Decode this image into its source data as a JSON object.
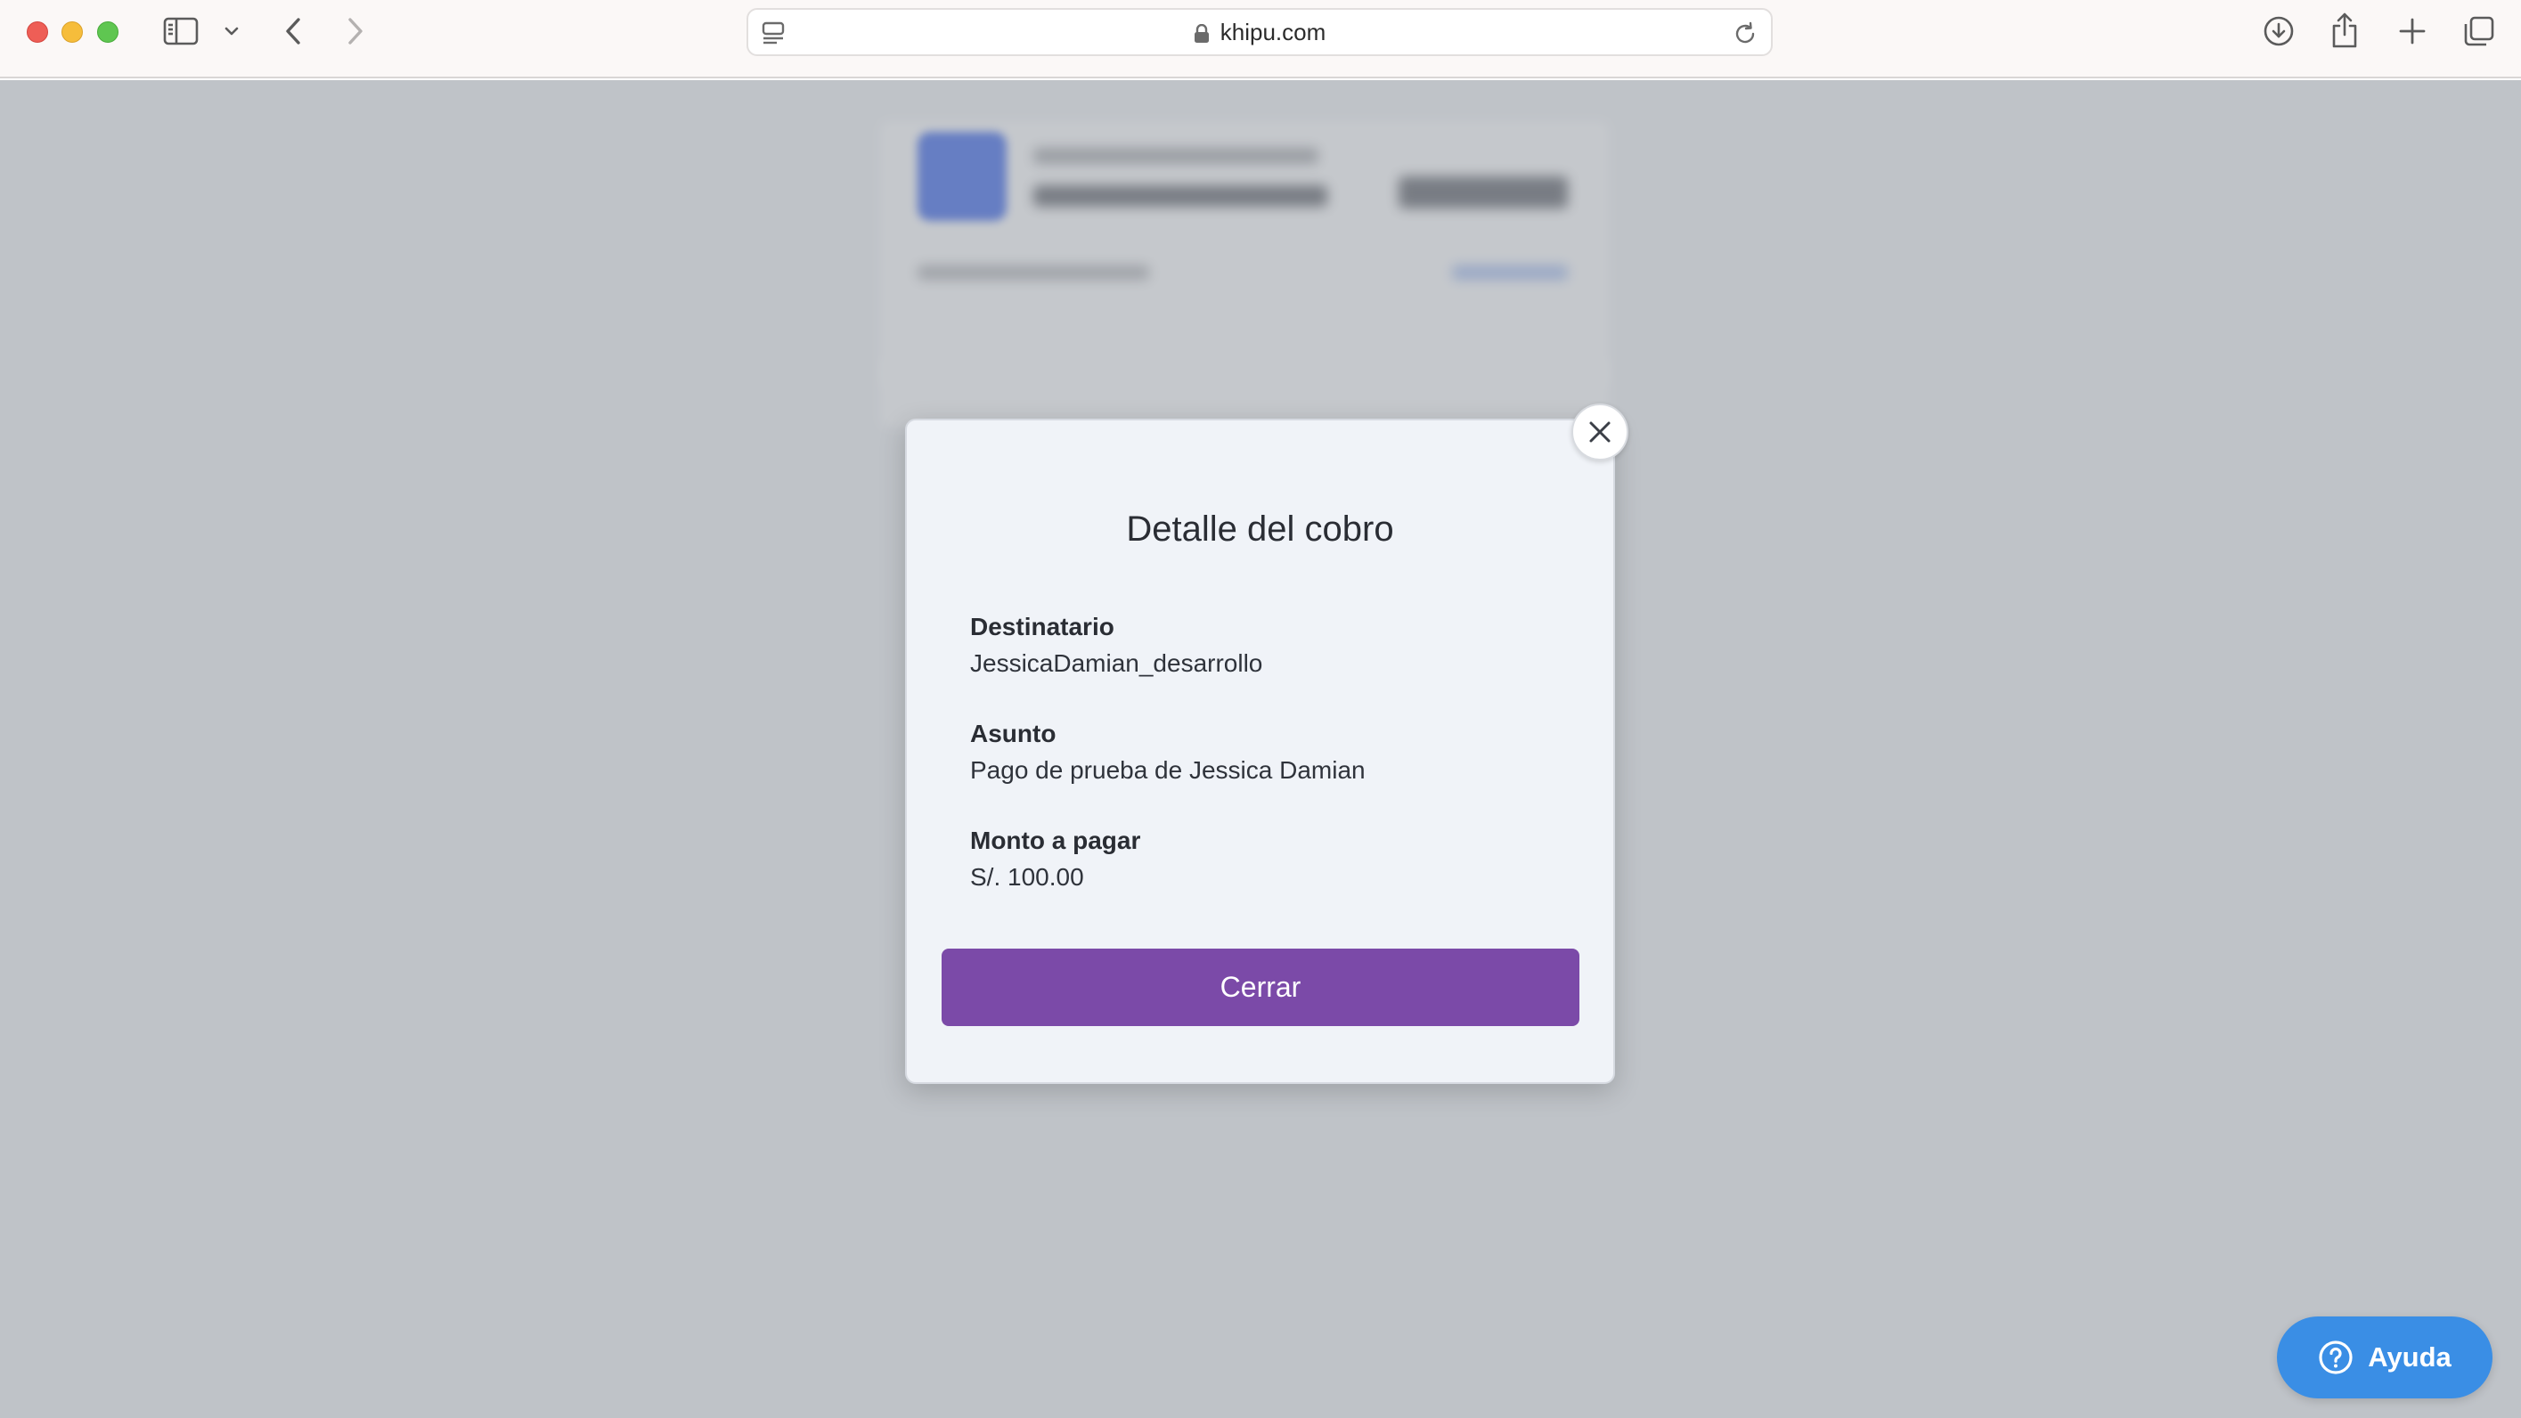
{
  "browser": {
    "url": "khipu.com"
  },
  "modal": {
    "title": "Detalle del cobro",
    "fields": [
      {
        "label": "Destinatario",
        "value": "JessicaDamian_desarrollo"
      },
      {
        "label": "Asunto",
        "value": "Pago de prueba de Jessica Damian"
      },
      {
        "label": "Monto a pagar",
        "value": "S/. 100.00"
      }
    ],
    "close_button_label": "Cerrar"
  },
  "help": {
    "label": "Ayuda"
  },
  "colors": {
    "primary_button": "#7b4aa8",
    "help_button": "#3a8ee5",
    "modal_background": "#f0f3f8"
  }
}
